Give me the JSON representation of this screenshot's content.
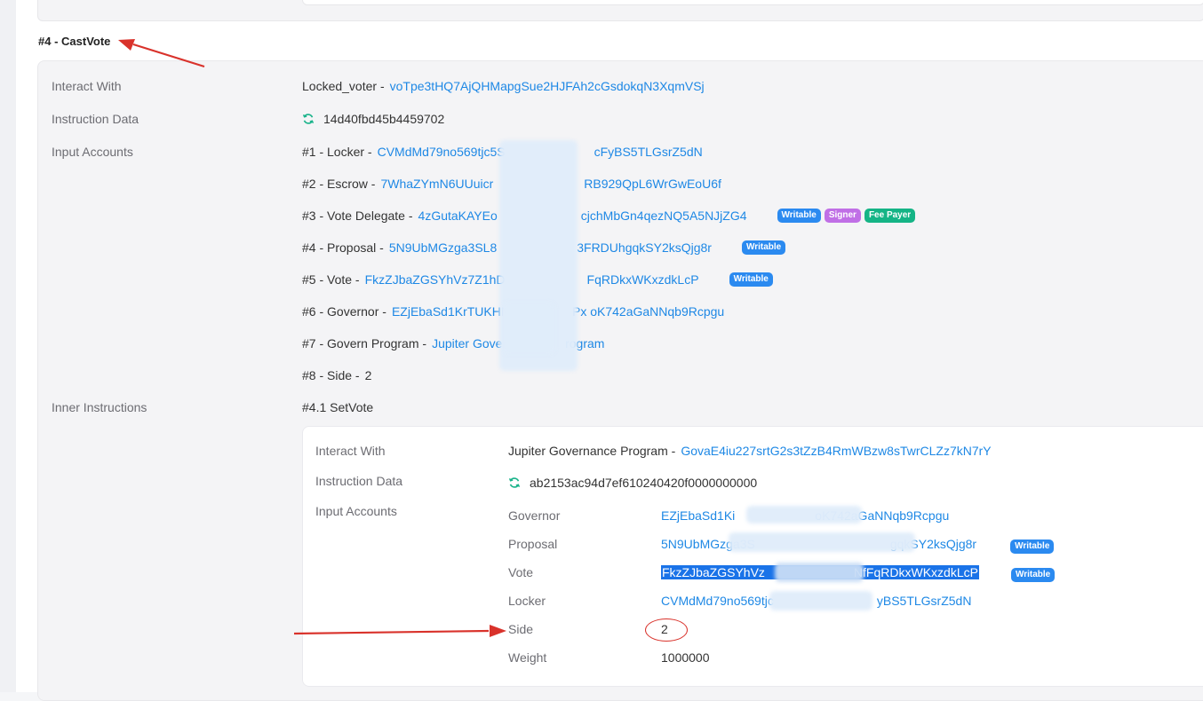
{
  "section_title": "#4 - CastVote",
  "labels": {
    "interact_with": "Interact With",
    "instruction_data": "Instruction Data",
    "input_accounts": "Input Accounts",
    "inner_instructions": "Inner Instructions"
  },
  "interact": {
    "name": "Locked_voter -",
    "address": "voTpe3tHQ7AjQHMapgSue2HJFAh2cGsdokqN3XqmVSj"
  },
  "instruction_data": "14d40fbd45b4459702",
  "accounts": [
    {
      "label": "#1 - Locker -",
      "value": "CVMdMd79no569tjc5S",
      "value_tail": "cFyBS5TLGsrZ5dN",
      "badges": []
    },
    {
      "label": "#2 - Escrow -",
      "value": "7WhaZYmN6UUuicr",
      "value_tail": "RB929QpL6WrGwEoU6f",
      "badges": []
    },
    {
      "label": "#3 - Vote Delegate -",
      "value": "4zGutaKAYEo",
      "value_tail": "cjchMbGn4qezNQ5A5NJjZG4",
      "badges": [
        "Writable",
        "Signer",
        "Fee Payer"
      ]
    },
    {
      "label": "#4 - Proposal -",
      "value": "5N9UbMGzga3SL8",
      "value_tail": "3FRDUhgqkSY2ksQjg8r",
      "badges": [
        "Writable"
      ]
    },
    {
      "label": "#5 - Vote -",
      "value": "FkzZJbaZGSYhVz7Z1hD",
      "value_tail": "FqRDkxWKxzdkLcP",
      "badges": [
        "Writable"
      ]
    },
    {
      "label": "#6 - Governor -",
      "value": "EZjEbaSd1KrTUKHN",
      "value_tail": "Px oK742aGaNNqb9Rcpgu",
      "badges": []
    },
    {
      "label": "#7 - Govern Program -",
      "value": "Jupiter Gover",
      "value_tail": "rogram",
      "badges": []
    },
    {
      "label": "#8 - Side -",
      "value": "2",
      "value_tail": "",
      "badges": []
    }
  ],
  "inner": {
    "title": "#4.1 SetVote",
    "labels": {
      "interact_with": "Interact With",
      "instruction_data": "Instruction Data",
      "input_accounts": "Input Accounts"
    },
    "interact": {
      "name": "Jupiter Governance Program -",
      "address": "GovaE4iu227srtG2s3tZzB4RmWBzw8sTwrCLZz7kN7rY"
    },
    "instruction_data": "ab2153ac94d7ef610240420f0000000000",
    "accounts": [
      {
        "key": "Governor",
        "value": "EZjEbaSd1Ki",
        "value_tail": "oK742aGaNNqb9Rcpgu",
        "badge": ""
      },
      {
        "key": "Proposal",
        "value": "5N9UbMGzga3S",
        "value_tail": "gqkSY2ksQjg8r",
        "badge": "Writable"
      },
      {
        "key": "Vote",
        "value": "FkzZJbaZGSYhVz",
        "value_tail": "NfFqRDkxWKxzdkLcP",
        "badge": "Writable"
      },
      {
        "key": "Locker",
        "value": "CVMdMd79no569tjc",
        "value_tail": "yBS5TLGsrZ5dN",
        "badge": ""
      },
      {
        "key": "Side",
        "value": "2",
        "value_tail": "",
        "badge": ""
      },
      {
        "key": "Weight",
        "value": "1000000",
        "value_tail": "",
        "badge": ""
      }
    ]
  },
  "colors": {
    "link": "#1e88e5",
    "writable": "#2b8af0",
    "signer": "#c06fe6",
    "fee_payer": "#15b486",
    "annotation": "#d9322b"
  }
}
